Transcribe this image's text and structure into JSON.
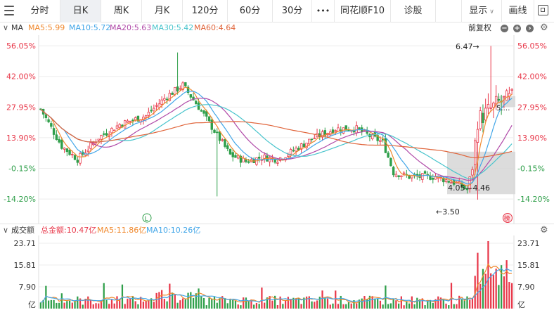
{
  "toolbar": {
    "tabs": [
      {
        "label": "分时"
      },
      {
        "label": "日K"
      },
      {
        "label": "周K"
      },
      {
        "label": "月K"
      },
      {
        "label": "120分"
      },
      {
        "label": "60分"
      },
      {
        "label": "30分"
      },
      {
        "label": "•••"
      },
      {
        "label": "同花顺F10"
      },
      {
        "label": "诊股"
      }
    ],
    "display_label": "显示",
    "draw_label": "画线"
  },
  "ma_bar": {
    "title": "MA",
    "ma5": "MA5:5.99",
    "ma10": "MA10:5.72",
    "ma20": "MA20:5.63",
    "ma30": "MA30:5.42",
    "ma60": "MA60:4.64",
    "adjust": "前复权"
  },
  "volume_bar": {
    "title": "成交额",
    "total": "总金额:10.47亿",
    "ma5": "MA5:11.86亿",
    "ma10": "MA10:10.26亿"
  },
  "colors": {
    "up": "#e8384a",
    "down": "#2f9f4a",
    "ma5": "#f0892e",
    "ma10": "#42a6e8",
    "ma20": "#b04aa8",
    "ma30": "#48c4cc",
    "ma60": "#e0643a",
    "axis_red": "#e8384a",
    "axis_green": "#2f9f4a"
  },
  "chart_data": [
    {
      "type": "candlestick",
      "y_ticks": [
        "56.05%",
        "42.00%",
        "27.95%",
        "13.90%",
        "-0.15%",
        "-14.20%"
      ],
      "y_tick_values": [
        56.05,
        42.0,
        27.95,
        13.9,
        -0.15,
        -14.2
      ],
      "ylim": [
        -19,
        59
      ],
      "annotations": [
        {
          "text": "6.47→",
          "kind": "high"
        },
        {
          "text": "←3.50",
          "kind": "low"
        },
        {
          "text": "4.05—4.46",
          "kind": "range"
        },
        {
          "text": "5.…",
          "kind": "current"
        }
      ],
      "markers": [
        {
          "text": "L"
        },
        {
          "text": "榜"
        }
      ],
      "n_bars": 180,
      "close_pct_path": [
        [
          0,
          27
        ],
        [
          8,
          10
        ],
        [
          14,
          4
        ],
        [
          22,
          14
        ],
        [
          30,
          20
        ],
        [
          40,
          24
        ],
        [
          48,
          33
        ],
        [
          54,
          38
        ],
        [
          60,
          28
        ],
        [
          66,
          17
        ],
        [
          72,
          6
        ],
        [
          78,
          3
        ],
        [
          84,
          5
        ],
        [
          90,
          4
        ],
        [
          96,
          8
        ],
        [
          104,
          14
        ],
        [
          112,
          18
        ],
        [
          120,
          18
        ],
        [
          126,
          14
        ],
        [
          130,
          12
        ],
        [
          134,
          -2
        ],
        [
          140,
          -4
        ],
        [
          150,
          -4
        ],
        [
          158,
          -7
        ],
        [
          162,
          -10
        ],
        [
          164,
          0
        ],
        [
          166,
          22
        ],
        [
          170,
          26
        ],
        [
          174,
          30
        ],
        [
          179,
          32
        ]
      ]
    },
    {
      "type": "bar",
      "y_ticks": [
        "23.71",
        "15.81",
        "7.90",
        "亿"
      ],
      "y_tick_values": [
        23.71,
        15.81,
        7.9,
        0
      ],
      "ylim": [
        0,
        25
      ]
    }
  ]
}
